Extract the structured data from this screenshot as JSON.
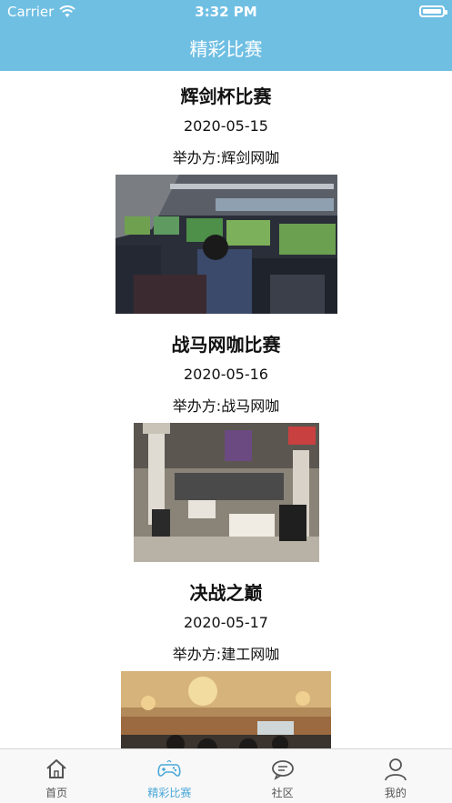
{
  "status": {
    "carrier": "Carrier",
    "time": "3:32 PM"
  },
  "nav": {
    "title": "精彩比赛"
  },
  "matches": [
    {
      "title": "辉剑杯比赛",
      "date": "2020-05-15",
      "host": "举办方:辉剑网咖"
    },
    {
      "title": "战马网咖比赛",
      "date": "2020-05-16",
      "host": "举办方:战马网咖"
    },
    {
      "title": "决战之巅",
      "date": "2020-05-17",
      "host": "举办方:建工网咖"
    }
  ],
  "tabs": [
    {
      "label": "首页",
      "icon": "home-icon"
    },
    {
      "label": "精彩比赛",
      "icon": "gamepad-icon"
    },
    {
      "label": "社区",
      "icon": "chat-icon"
    },
    {
      "label": "我的",
      "icon": "user-icon"
    }
  ],
  "colors": {
    "header": "#6fbfe3",
    "tab_active": "#4aa8d8",
    "tab_inactive": "#555555"
  }
}
